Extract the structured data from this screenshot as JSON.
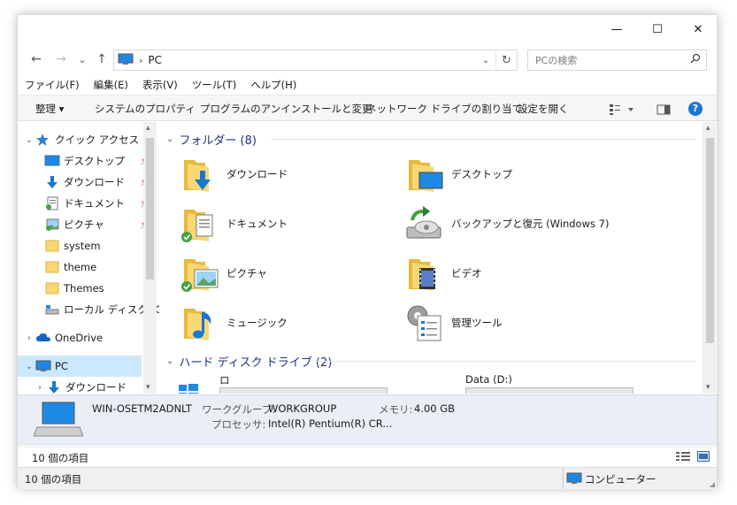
{
  "window": {
    "minimize_glyph": "—",
    "maximize_glyph": "☐",
    "close_glyph": "✕"
  },
  "nav": {
    "back_glyph": "←",
    "forward_glyph": "→",
    "recent_glyph": "⌄",
    "up_glyph": "↑",
    "address_icon": "computer-icon",
    "address_separator": "›",
    "address_path": "PC",
    "refresh_glyph": "↻",
    "search_placeholder": "PCの検索",
    "search_glyph": "⚲"
  },
  "menu": [
    "ファイル(F)",
    "編集(E)",
    "表示(V)",
    "ツール(T)",
    "ヘルプ(H)"
  ],
  "commands": {
    "organize": "整理 ▾",
    "system_properties": "システムのプロパティ",
    "uninstall": "プログラムのアンインストールと変更",
    "map_drive": "ネットワーク ドライブの割り当て",
    "open_settings": "設定を開く",
    "help_glyph": "?"
  },
  "sidebar": {
    "quick_access": "クイック アクセス",
    "items": [
      {
        "label": "デスクトップ",
        "icon": "desktop-icon",
        "pinned": true
      },
      {
        "label": "ダウンロード",
        "icon": "download-icon",
        "pinned": true
      },
      {
        "label": "ドキュメント",
        "icon": "documents-icon",
        "pinned": true
      },
      {
        "label": "ピクチャ",
        "icon": "pictures-icon",
        "pinned": true
      },
      {
        "label": "system",
        "icon": "folder-icon",
        "pinned": false
      },
      {
        "label": "theme",
        "icon": "folder-icon",
        "pinned": false
      },
      {
        "label": "Themes",
        "icon": "folder-icon",
        "pinned": false
      },
      {
        "label": "ローカル ディスク (C",
        "icon": "drive-icon",
        "pinned": false
      }
    ],
    "onedrive": "OneDrive",
    "pc": "PC",
    "pc_child": "ダウンロード"
  },
  "content": {
    "folders_header": "フォルダー (8)",
    "folders": [
      {
        "label": "ダウンロード",
        "icon": "download-folder-icon"
      },
      {
        "label": "デスクトップ",
        "icon": "desktop-folder-icon"
      },
      {
        "label": "ドキュメント",
        "icon": "documents-folder-icon"
      },
      {
        "label": "バックアップと復元 (Windows 7)",
        "icon": "backup-restore-icon"
      },
      {
        "label": "ピクチャ",
        "icon": "pictures-folder-icon"
      },
      {
        "label": "ビデオ",
        "icon": "videos-folder-icon"
      },
      {
        "label": "ミュージック",
        "icon": "music-folder-icon"
      },
      {
        "label": "管理ツール",
        "icon": "admin-tools-icon"
      }
    ],
    "drives_header": "ハード ディスク ドライブ (2)",
    "drives": [
      {
        "label": "ローカル ディスク (C:)"
      },
      {
        "label": "Data (D:)"
      }
    ]
  },
  "details": {
    "computer_name": "WIN-OSETM2ADNLT",
    "workgroup_label": "ワークグループ:",
    "workgroup_value": "WORKGROUP",
    "memory_label": "メモリ:",
    "memory_value": "4.00 GB",
    "processor_label": "プロセッサ:",
    "processor_value": "Intel(R) Pentium(R) CR..."
  },
  "status": {
    "item_count": "10 個の項目",
    "item_count_bottom": "10 個の項目",
    "location": "コンピューター"
  }
}
